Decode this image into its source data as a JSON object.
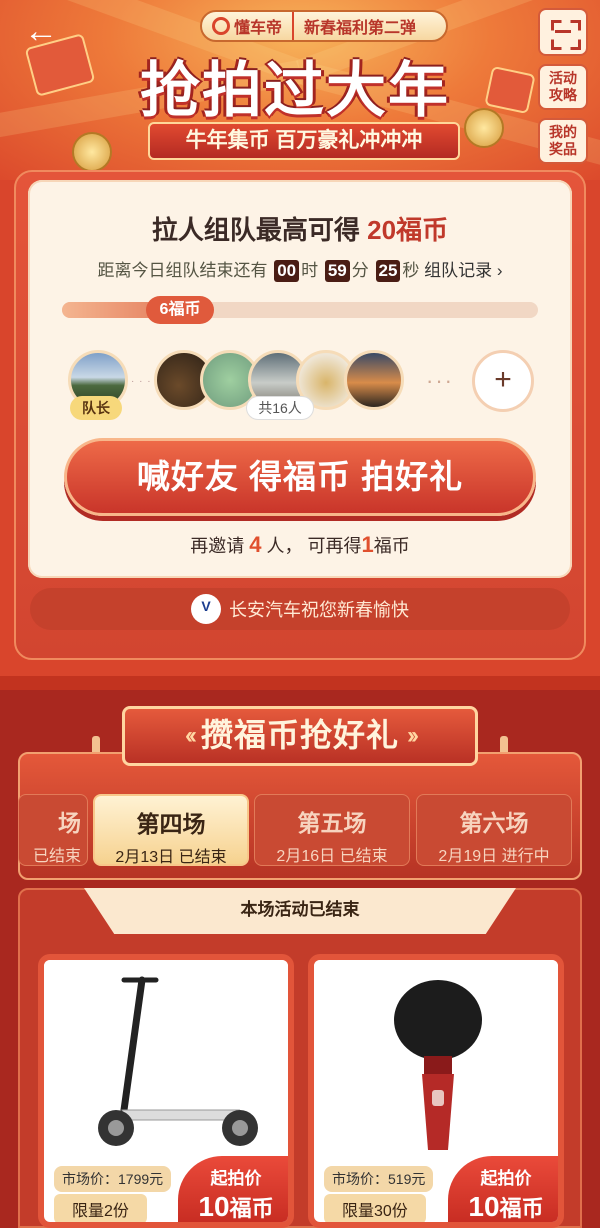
{
  "header": {
    "brand": "懂车帝",
    "campaign_tag": "新春福利第二弹",
    "title": "抢拍过大年",
    "subtitle": "牛年集币 百万豪礼冲冲冲",
    "side_buttons": [
      {
        "label": "活动\n攻略"
      },
      {
        "label": "我的\n奖品"
      }
    ]
  },
  "team": {
    "title_prefix": "拉人组队最高可得",
    "title_reward": "20福币",
    "countdown_prefix": "距离今日组队结束还有",
    "hours": "00",
    "hours_unit": "时",
    "minutes": "59",
    "minutes_unit": "分",
    "seconds": "25",
    "seconds_unit": "秒",
    "record_link": "组队记录 ›",
    "progress_label": "6福币",
    "progress_fraction": 0.3,
    "leader_tag": "队长",
    "member_count": "共16人",
    "add_icon": "+",
    "invite_button": "喊好友 得福币 拍好礼",
    "invite_note_1": "再邀请",
    "invite_count": "4",
    "invite_note_2": "人，  可再得",
    "invite_reward": "1",
    "invite_note_3": "福币",
    "sponsor": "长安汽车祝您新春愉快"
  },
  "auction": {
    "section_title": "攒福币抢好礼",
    "tabs": [
      {
        "name": "场",
        "date": "已结束"
      },
      {
        "name": "第四场",
        "date": "2月13日 已结束"
      },
      {
        "name": "第五场",
        "date": "2月16日 已结束"
      },
      {
        "name": "第六场",
        "date": "2月19日 进行中"
      }
    ],
    "status": "本场活动已结束",
    "products": [
      {
        "market": "市场价：1799元",
        "limit": "限量2份",
        "bid_label": "起拍价",
        "bid_value": "10",
        "bid_unit": "福币"
      },
      {
        "market": "市场价：519元",
        "limit": "限量30份",
        "bid_label": "起拍价",
        "bid_value": "10",
        "bid_unit": "福币"
      }
    ]
  },
  "colors": {
    "primary": "#d9452c",
    "accent": "#c0392b",
    "gold": "#f6d28f"
  }
}
